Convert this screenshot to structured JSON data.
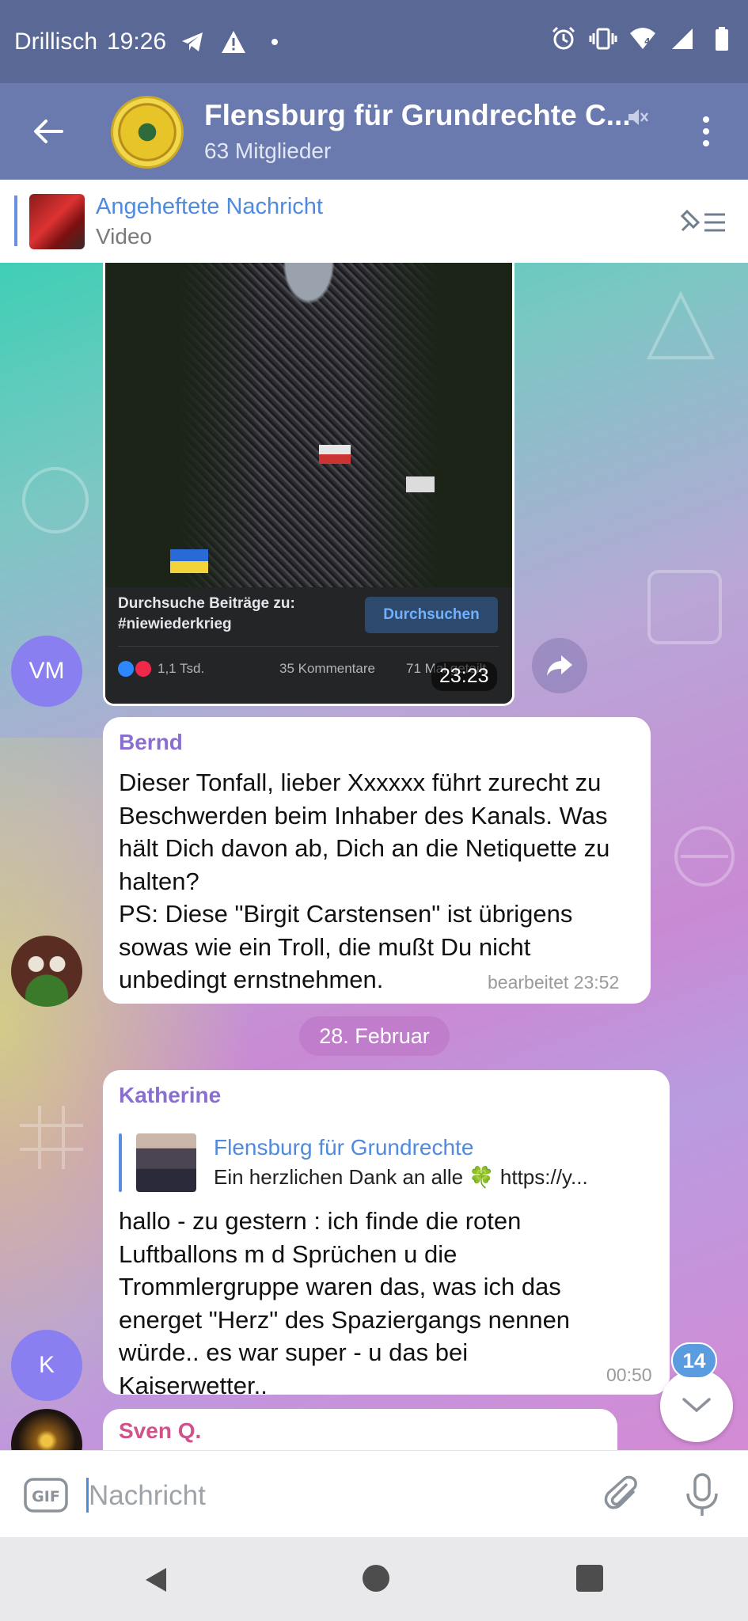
{
  "status_bar": {
    "carrier": "Drillisch",
    "time": "19:26",
    "network_badge": "4"
  },
  "header": {
    "title": "Flensburg für Grundrechte C...",
    "subtitle": "63 Mitglieder"
  },
  "pinned": {
    "title": "Angeheftete Nachricht",
    "subtitle": "Video"
  },
  "media_message": {
    "fb_search_text": "Durchsuche Beiträge zu: #niewiederkrieg",
    "fb_search_button": "Durchsuchen",
    "fb_reactions": "1,1 Tsd.",
    "fb_comments": "35 Kommentare",
    "fb_shares": "71 Mal geteilt",
    "time": "23:23",
    "sender_initials": "VM"
  },
  "messages": [
    {
      "sender": "Bernd",
      "sender_color": "#8a6ed0",
      "text": "Dieser Tonfall, lieber Xxxxxx führt zurecht zu Beschwerden beim Inhaber des Kanals. Was hält Dich davon ab, Dich an die Netiquette zu halten?\nPS: Diese \"Birgit Carstensen\" ist übrigens sowas wie ein Troll, die mußt Du nicht unbedingt ernstnehmen.",
      "meta": "bearbeitet 23:52"
    },
    {
      "sender": "Katherine",
      "sender_color": "#8a6ed0",
      "reply_title": "Flensburg für Grundrechte",
      "reply_text": "Ein herzlichen Dank an alle 🍀  https://y...",
      "text": "hallo - zu gestern : ich finde die roten Luftballons m d Sprüchen u die Trommlergruppe waren das, was ich das energet \"Herz\" des Spaziergangs nennen würde.. es war super - u das bei Kaiserwetter..",
      "meta": "00:50",
      "avatar_initial": "K"
    },
    {
      "sender": "Sven Q.",
      "sender_color": "#d0528a"
    }
  ],
  "date_separator": "28. Februar",
  "unread_count": "14",
  "composer": {
    "gif_label": "GIF",
    "placeholder": "Nachricht"
  },
  "colors": {
    "status_bar": "#5a6896",
    "header": "#6a7aae",
    "link_blue": "#4f8ade",
    "avatar_purple": "#8a7ff0"
  }
}
